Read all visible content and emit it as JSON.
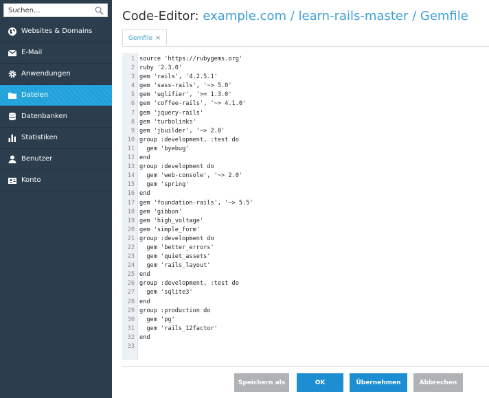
{
  "search": {
    "placeholder": "Suchen..."
  },
  "sidebar": {
    "items": [
      {
        "label": "Websites & Domains",
        "icon": "globe-icon"
      },
      {
        "label": "E-Mail",
        "icon": "mail-icon"
      },
      {
        "label": "Anwendungen",
        "icon": "gear-icon"
      },
      {
        "label": "Dateien",
        "icon": "folder-icon",
        "active": true
      },
      {
        "label": "Datenbanken",
        "icon": "database-icon"
      },
      {
        "label": "Statistiken",
        "icon": "bar-chart-icon"
      },
      {
        "label": "Benutzer",
        "icon": "user-icon"
      },
      {
        "label": "Konto",
        "icon": "account-icon"
      }
    ]
  },
  "header": {
    "prefix": "Code-Editor:",
    "path": "example.com / learn-rails-master / Gemfile"
  },
  "tab": {
    "label": "Gemfile",
    "close": "×"
  },
  "editor": {
    "lines": [
      {
        "n": "1",
        "code": "source 'https://rubygems.org'"
      },
      {
        "n": "2",
        "code": "ruby '2.3.0'"
      },
      {
        "n": "3",
        "code": "gem 'rails', '4.2.5.1'"
      },
      {
        "n": "4",
        "code": "gem 'sass-rails', '~> 5.0'"
      },
      {
        "n": "5",
        "code": "gem 'uglifier', '>= 1.3.0'"
      },
      {
        "n": "6",
        "code": "gem 'coffee-rails', '~> 4.1.0'"
      },
      {
        "n": "7",
        "code": "gem 'jquery-rails'"
      },
      {
        "n": "8",
        "code": "gem 'turbolinks'"
      },
      {
        "n": "9",
        "code": "gem 'jbuilder', '~> 2.0'"
      },
      {
        "n": "10",
        "code": "group :development, :test do"
      },
      {
        "n": "11",
        "code": "  gem 'byebug'"
      },
      {
        "n": "12",
        "code": "end"
      },
      {
        "n": "13",
        "code": "group :development do"
      },
      {
        "n": "14",
        "code": "  gem 'web-console', '~> 2.0'"
      },
      {
        "n": "15",
        "code": "  gem 'spring'"
      },
      {
        "n": "16",
        "code": "end"
      },
      {
        "n": "17",
        "code": "gem 'foundation-rails', '~> 5.5'"
      },
      {
        "n": "18",
        "code": "gem 'gibbon'"
      },
      {
        "n": "19",
        "code": "gem 'high_voltage'"
      },
      {
        "n": "20",
        "code": "gem 'simple_form'"
      },
      {
        "n": "21",
        "code": "group :development do"
      },
      {
        "n": "22",
        "code": "  gem 'better_errors'"
      },
      {
        "n": "23",
        "code": "  gem 'quiet_assets'"
      },
      {
        "n": "24",
        "code": "  gem 'rails_layout'"
      },
      {
        "n": "25",
        "code": "end"
      },
      {
        "n": "26",
        "code": "group :development, :test do"
      },
      {
        "n": "27",
        "code": "  gem 'sqlite3'"
      },
      {
        "n": "28",
        "code": "end"
      },
      {
        "n": "29",
        "code": "group :production do"
      },
      {
        "n": "30",
        "code": "  gem 'pg'"
      },
      {
        "n": "31",
        "code": "  gem 'rails_12factor'"
      },
      {
        "n": "32",
        "code": "end"
      },
      {
        "n": "33",
        "code": ""
      }
    ]
  },
  "buttons": {
    "save_as": "Speichern als",
    "ok": "OK",
    "apply": "Übernehmen",
    "cancel": "Abbrechen"
  },
  "colors": {
    "sidebar": "#2c3d4e",
    "active": "#1ea1da",
    "accent": "#3e9fd8",
    "primary_button": "#1c8ed1",
    "grey_button": "#b0b3b6"
  }
}
